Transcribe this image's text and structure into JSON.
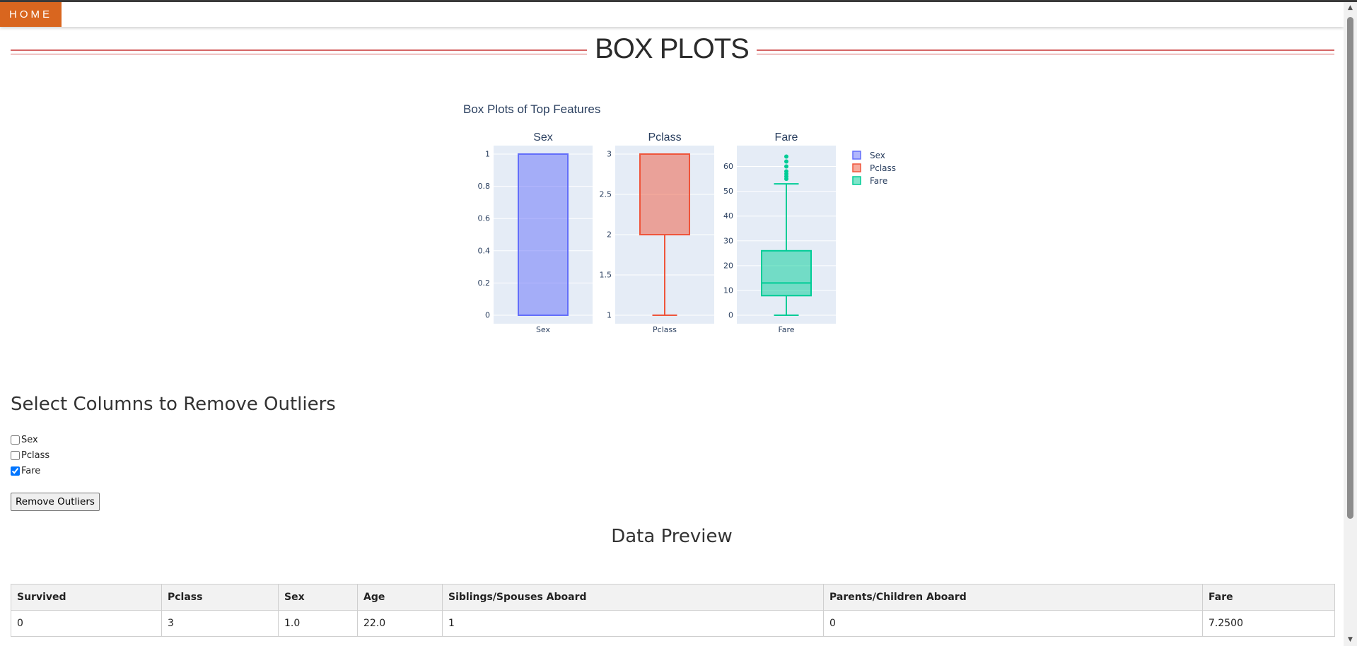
{
  "nav": {
    "home_label": "HOME"
  },
  "page": {
    "title": "BOX PLOTS"
  },
  "chart_data": {
    "type": "box",
    "title": "Box Plots of Top Features",
    "legend_position": "top-right",
    "grid": true,
    "subplots": [
      {
        "name": "Sex",
        "color": "#636efa",
        "ylim": [
          0,
          1
        ],
        "yticks": [
          0,
          0.2,
          0.4,
          0.6,
          0.8,
          1
        ],
        "ytick_labels": [
          "0",
          "0.2",
          "0.4",
          "0.6",
          "0.8",
          "1"
        ],
        "min": 0,
        "q1": 0,
        "median": 0,
        "q3": 1,
        "max": 1,
        "outliers": []
      },
      {
        "name": "Pclass",
        "color": "#ef553b",
        "ylim": [
          1,
          3
        ],
        "yticks": [
          1,
          1.5,
          2,
          2.5,
          3
        ],
        "ytick_labels": [
          "1",
          "1.5",
          "2",
          "2.5",
          "3"
        ],
        "min": 1,
        "q1": 2,
        "median": 3,
        "q3": 3,
        "max": 3,
        "outliers": []
      },
      {
        "name": "Fare",
        "color": "#00cc96",
        "ylim": [
          0,
          65
        ],
        "yticks": [
          0,
          10,
          20,
          30,
          40,
          50,
          60
        ],
        "ytick_labels": [
          "0",
          "10",
          "20",
          "30",
          "40",
          "50",
          "60"
        ],
        "min": 0,
        "q1": 7.9,
        "median": 13,
        "q3": 26,
        "max": 53,
        "outliers": [
          55,
          56,
          57,
          58,
          60,
          62,
          64
        ]
      }
    ]
  },
  "outliers_section": {
    "title": "Select Columns to Remove Outliers",
    "columns": [
      {
        "label": "Sex",
        "checked": false
      },
      {
        "label": "Pclass",
        "checked": false
      },
      {
        "label": "Fare",
        "checked": true
      }
    ],
    "button_label": "Remove Outliers"
  },
  "preview": {
    "title": "Data Preview",
    "headers": [
      "Survived",
      "Pclass",
      "Sex",
      "Age",
      "Siblings/Spouses Aboard",
      "Parents/Children Aboard",
      "Fare"
    ],
    "rows": [
      [
        "0",
        "3",
        "1.0",
        "22.0",
        "1",
        "0",
        "7.2500"
      ]
    ]
  }
}
